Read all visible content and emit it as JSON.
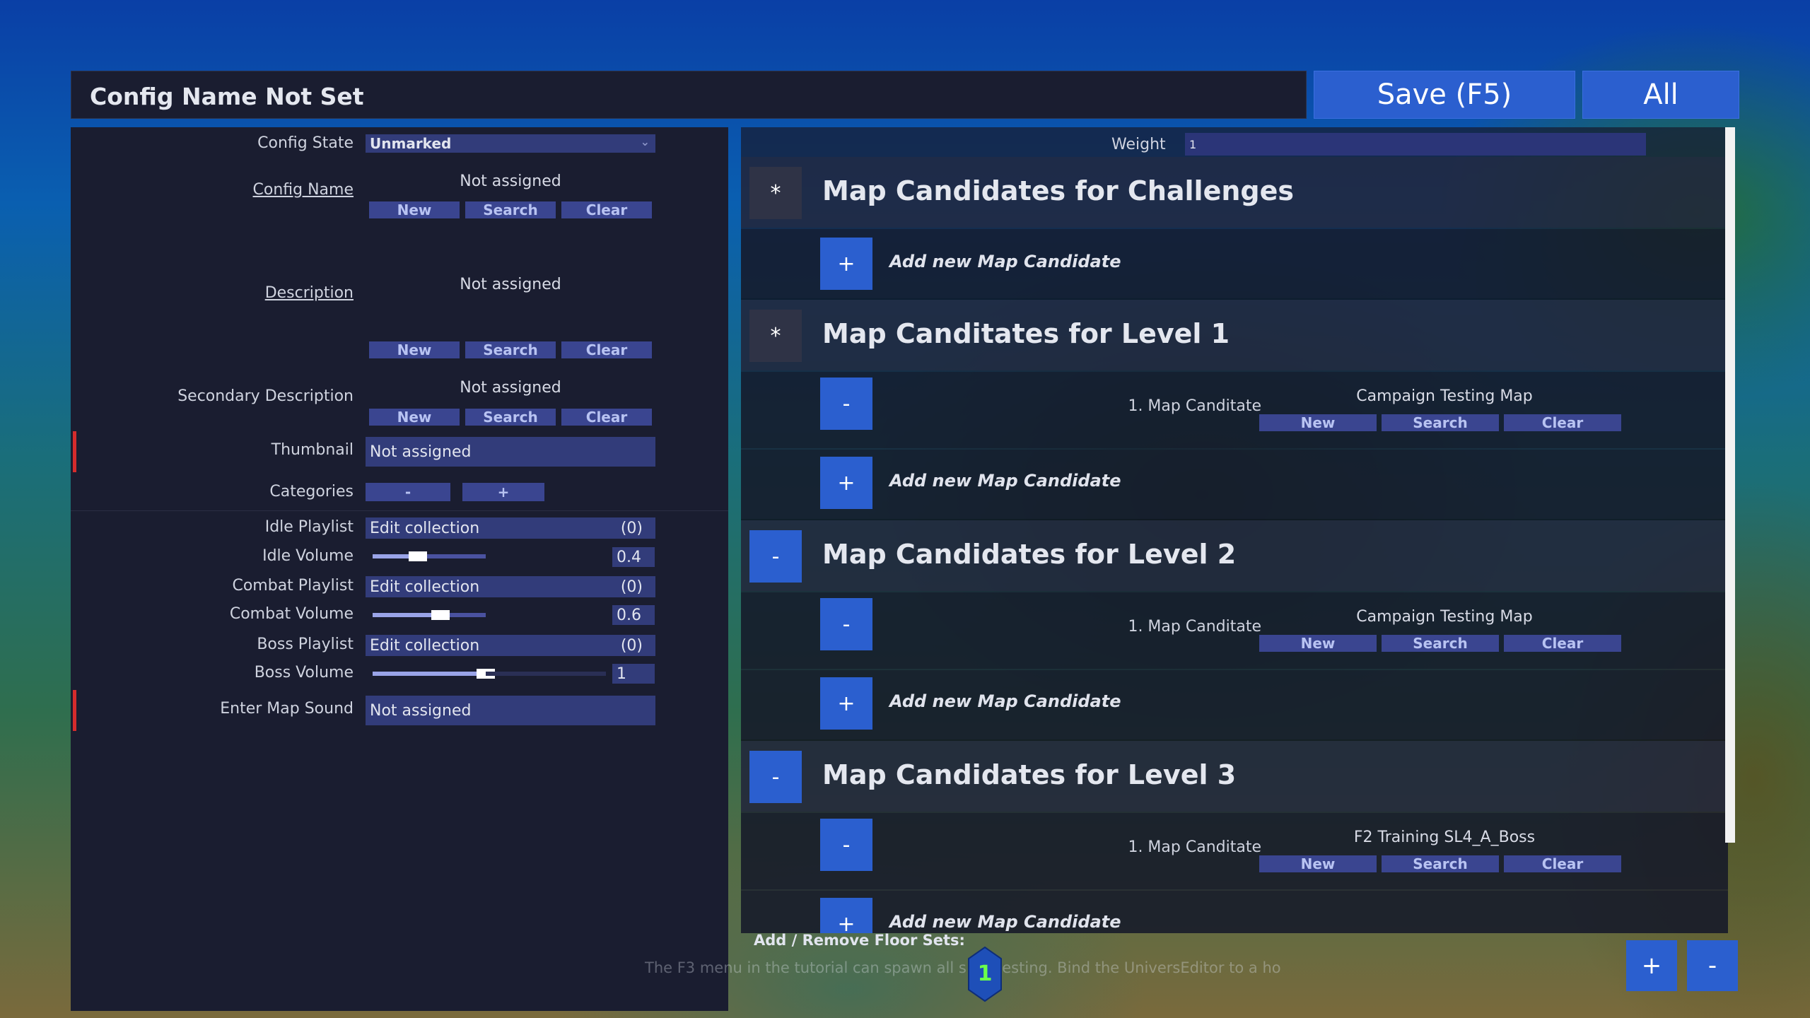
{
  "header": {
    "title": "Config Name Not Set",
    "save_label": "Save (F5)",
    "all_label": "All"
  },
  "left": {
    "config_state": {
      "label": "Config State",
      "value": "Unmarked"
    },
    "config_name": {
      "label": "Config Name",
      "value": "Not assigned",
      "buttons": [
        "New",
        "Search",
        "Clear"
      ]
    },
    "description": {
      "label": "Description",
      "value": "Not assigned",
      "buttons": [
        "New",
        "Search",
        "Clear"
      ]
    },
    "secondary_description": {
      "label": "Secondary Description",
      "value": "Not assigned",
      "buttons": [
        "New",
        "Search",
        "Clear"
      ]
    },
    "thumbnail": {
      "label": "Thumbnail",
      "value": "Not assigned"
    },
    "categories": {
      "label": "Categories",
      "minus": "-",
      "plus": "+"
    },
    "idle_playlist": {
      "label": "Idle Playlist",
      "value": "Edit collection",
      "count": "(0)"
    },
    "idle_volume": {
      "label": "Idle Volume",
      "value": "0.4",
      "level": 0.4
    },
    "combat_playlist": {
      "label": "Combat Playlist",
      "value": "Edit collection",
      "count": "(0)"
    },
    "combat_volume": {
      "label": "Combat Volume",
      "value": "0.6",
      "level": 0.6
    },
    "boss_playlist": {
      "label": "Boss Playlist",
      "value": "Edit collection",
      "count": "(0)"
    },
    "boss_volume": {
      "label": "Boss Volume",
      "value": "1",
      "level": 1.0
    },
    "enter_map_sound": {
      "label": "Enter Map Sound",
      "value": "Not assigned"
    }
  },
  "right": {
    "weight": {
      "label": "Weight",
      "value": "1"
    },
    "add_candidate_label": "Add new Map Candidate",
    "sections": [
      {
        "title": "Map Candidates for Challenges",
        "toggle": "*",
        "candidates": []
      },
      {
        "title": "Map Canditates for Level 1",
        "toggle": "*",
        "candidates": [
          {
            "label": "1. Map Canditate",
            "value": "Campaign Testing Map",
            "buttons": [
              "New",
              "Search",
              "Clear"
            ]
          }
        ]
      },
      {
        "title": "Map Candidates for Level 2",
        "toggle": "-",
        "candidates": [
          {
            "label": "1. Map Canditate",
            "value": "Campaign Testing Map",
            "buttons": [
              "New",
              "Search",
              "Clear"
            ]
          }
        ]
      },
      {
        "title": "Map Candidates for Level 3",
        "toggle": "-",
        "candidates": [
          {
            "label": "1. Map Canditate",
            "value": "F2 Training SL4_A_Boss",
            "buttons": [
              "New",
              "Search",
              "Clear"
            ]
          }
        ]
      }
    ]
  },
  "bottom": {
    "floor_sets_label": "Add / Remove Floor Sets:",
    "hint_text": "The F3 menu in the tutorial can spawn all     s for testing. Bind the UniversEditor to a ho",
    "plus": "+",
    "minus": "-",
    "badge_value": "1"
  },
  "colors": {
    "accent": "#2b5fcf",
    "panel": "#1a1d30",
    "field": "#323c7a",
    "button": "#3a4590",
    "required": "#d62c2c"
  },
  "icons": {
    "dropdown": "chevron-down-icon",
    "add": "plus-icon",
    "remove": "minus-icon",
    "expand": "asterisk-icon",
    "badge": "hexagon-badge-icon"
  }
}
